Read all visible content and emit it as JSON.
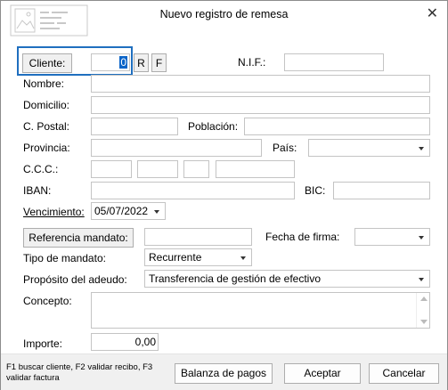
{
  "window": {
    "title": "Nuevo registro de remesa",
    "close_glyph": "✕",
    "logo_icon": "app-logo-icon"
  },
  "cliente": {
    "button": "Cliente:",
    "value": "0",
    "r_button": "R",
    "f_button": "F"
  },
  "labels": {
    "nif": "N.I.F.:",
    "nombre": "Nombre:",
    "domicilio": "Domicilio:",
    "cpostal": "C. Postal:",
    "poblacion": "Población:",
    "provincia": "Provincia:",
    "pais": "País:",
    "ccc": "C.C.C.:",
    "iban": "IBAN:",
    "bic": "BIC:",
    "vencimiento": "Vencimiento:",
    "fecha_firma": "Fecha de firma:",
    "tipo_mandato": "Tipo de mandato:",
    "proposito": "Propósito del adeudo:",
    "concepto": "Concepto:",
    "importe": "Importe:"
  },
  "values": {
    "vencimiento": "05/07/2022",
    "tipo_mandato": "Recurrente",
    "proposito": "Transferencia de gestión de efectivo",
    "importe": "0,00"
  },
  "buttons": {
    "referencia_mandato": "Referencia mandato:",
    "balanza": "Balanza de pagos",
    "aceptar": "Aceptar",
    "cancelar": "Cancelar"
  },
  "footer": {
    "hint": "F1 buscar cliente, F2 validar recibo, F3 validar factura"
  }
}
